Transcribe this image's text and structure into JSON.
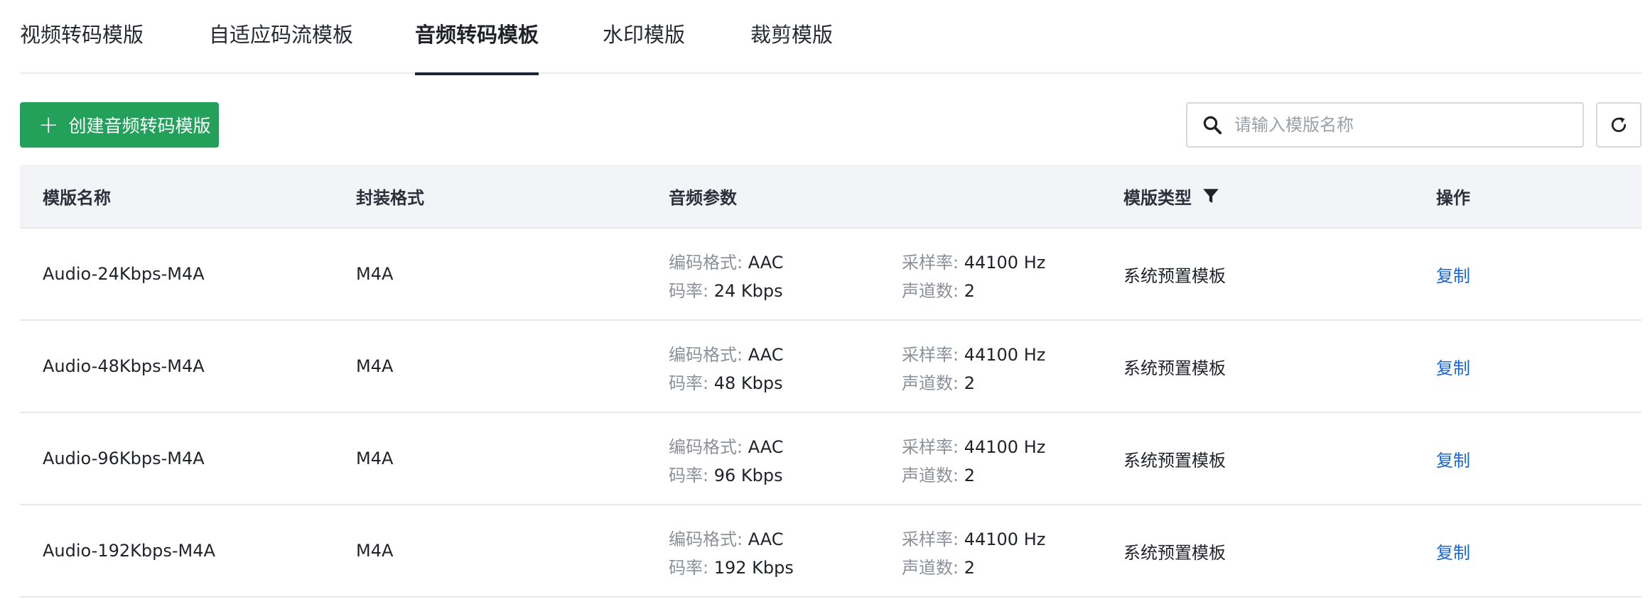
{
  "tabs": [
    {
      "label": "视频转码模版",
      "active": false
    },
    {
      "label": "自适应码流模板",
      "active": false
    },
    {
      "label": "音频转码模板",
      "active": true
    },
    {
      "label": "水印模版",
      "active": false
    },
    {
      "label": "裁剪模版",
      "active": false
    }
  ],
  "toolbar": {
    "create_label": "创建音频转码模版",
    "search_placeholder": "请输入模版名称",
    "search_value": ""
  },
  "table": {
    "headers": {
      "name": "模版名称",
      "format": "封装格式",
      "audio_params": "音频参数",
      "type": "模版类型",
      "actions": "操作"
    },
    "param_labels": {
      "codec": "编码格式: ",
      "bitrate": "码率: ",
      "sample_rate": "采样率: ",
      "channels": "声道数: "
    },
    "rows": [
      {
        "name": "Audio-24Kbps-M4A",
        "format": "M4A",
        "codec": "AAC",
        "bitrate": "24 Kbps",
        "sample_rate": "44100 Hz",
        "channels": "2",
        "type": "系统预置模板",
        "action": "复制"
      },
      {
        "name": "Audio-48Kbps-M4A",
        "format": "M4A",
        "codec": "AAC",
        "bitrate": "48 Kbps",
        "sample_rate": "44100 Hz",
        "channels": "2",
        "type": "系统预置模板",
        "action": "复制"
      },
      {
        "name": "Audio-96Kbps-M4A",
        "format": "M4A",
        "codec": "AAC",
        "bitrate": "96 Kbps",
        "sample_rate": "44100 Hz",
        "channels": "2",
        "type": "系统预置模板",
        "action": "复制"
      },
      {
        "name": "Audio-192Kbps-M4A",
        "format": "M4A",
        "codec": "AAC",
        "bitrate": "192 Kbps",
        "sample_rate": "44100 Hz",
        "channels": "2",
        "type": "系统预置模板",
        "action": "复制"
      }
    ]
  },
  "icons": {
    "search": "search-icon",
    "refresh": "refresh-icon",
    "filter": "filter-icon",
    "plus": "plus-icon"
  },
  "colors": {
    "primary_button": "#23a05a",
    "link": "#1664d9",
    "active_tab_indicator": "#1b2536",
    "header_bg": "#f2f4f8"
  }
}
